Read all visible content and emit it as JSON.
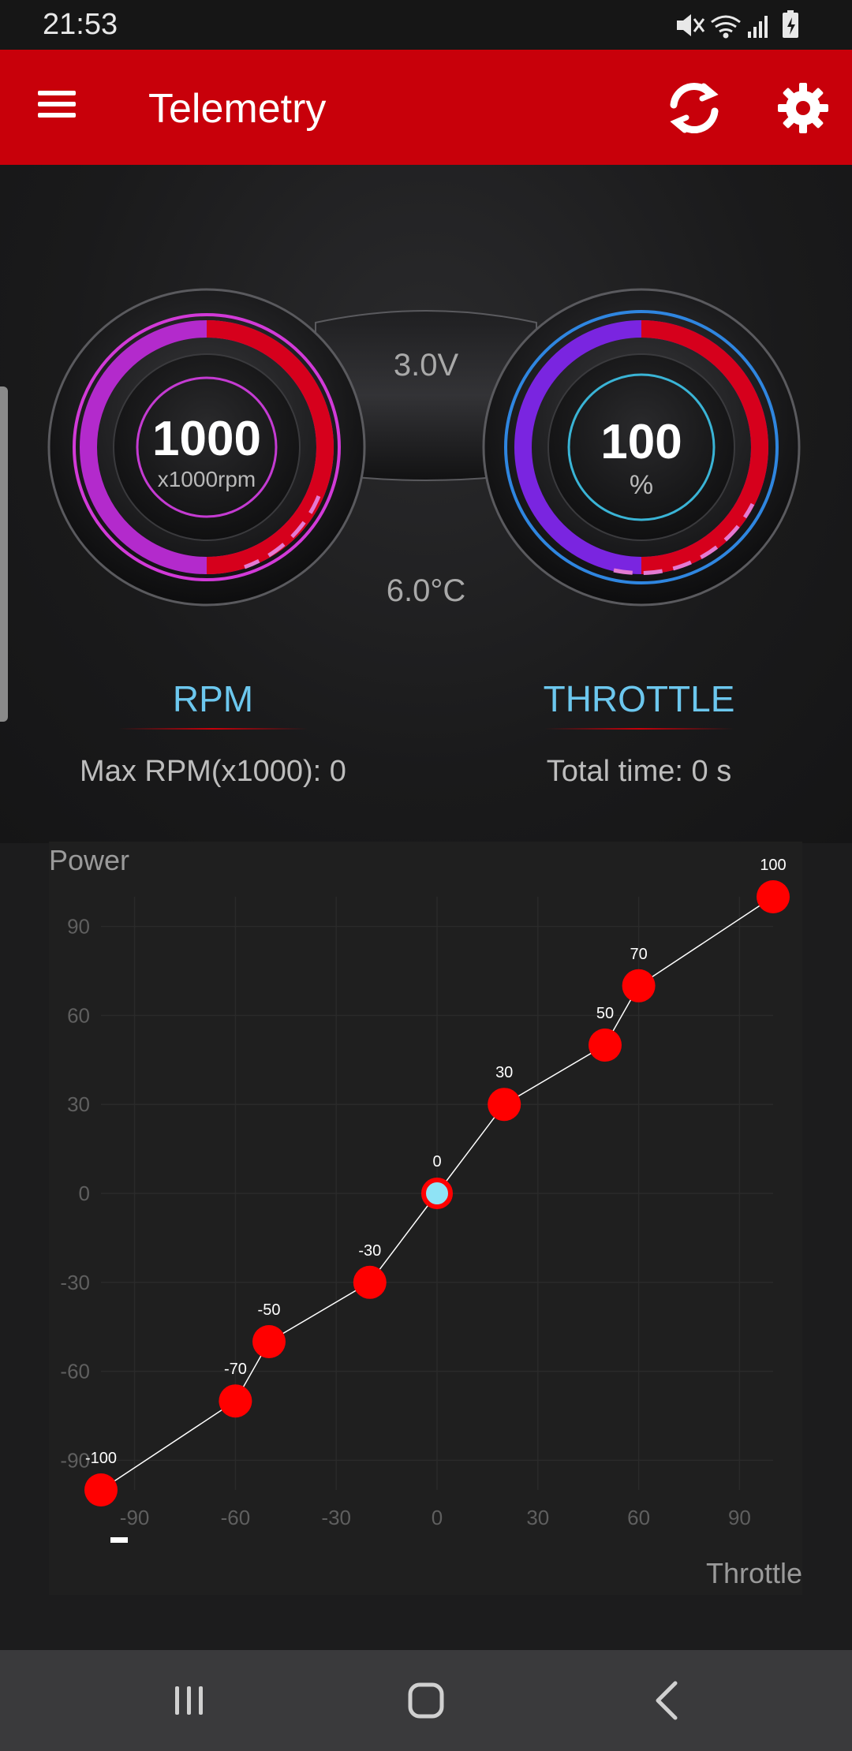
{
  "status_bar": {
    "time": "21:53",
    "icons": [
      "mute-icon",
      "wifi-icon",
      "signal-icon",
      "battery-icon"
    ]
  },
  "app_bar": {
    "title": "Telemetry",
    "menu_icon": "menu-icon",
    "sync_icon": "sync-icon",
    "settings_icon": "gear-icon"
  },
  "dashboard": {
    "rpm_gauge": {
      "value": "1000",
      "unit": "x1000rpm"
    },
    "throttle_gauge": {
      "value": "100",
      "unit": "%"
    },
    "voltage": "3.0V",
    "temperature": "6.0°C",
    "rpm_label": "RPM",
    "throttle_label": "THROTTLE",
    "max_rpm": "Max RPM(x1000): 0",
    "total_time": "Total time: 0 s"
  },
  "chart_data": {
    "type": "line",
    "xlabel": "Throttle",
    "ylabel": "Power",
    "xlim": [
      -100,
      100
    ],
    "ylim": [
      -100,
      100
    ],
    "x_ticks": [
      -90,
      -60,
      -30,
      0,
      30,
      60,
      90
    ],
    "y_ticks": [
      90,
      60,
      30,
      0,
      -30,
      -60,
      -90
    ],
    "grid": true,
    "points": [
      {
        "x": -100,
        "y": -100,
        "label": "-100"
      },
      {
        "x": -60,
        "y": -70,
        "label": "-70"
      },
      {
        "x": -50,
        "y": -50,
        "label": "-50"
      },
      {
        "x": -20,
        "y": -30,
        "label": "-30"
      },
      {
        "x": 0,
        "y": 0,
        "label": "0",
        "selected": true
      },
      {
        "x": 20,
        "y": 30,
        "label": "30"
      },
      {
        "x": 50,
        "y": 50,
        "label": "50"
      },
      {
        "x": 60,
        "y": 70,
        "label": "70"
      },
      {
        "x": 100,
        "y": 100,
        "label": "100"
      }
    ],
    "colors": {
      "point": "#ff0000",
      "selected": "#8fe3f5",
      "line": "#ffffff",
      "tick": "#5f5f5f"
    }
  },
  "nav_bar": {
    "recents_icon": "recents-icon",
    "home_icon": "home-icon",
    "back_icon": "back-icon"
  }
}
